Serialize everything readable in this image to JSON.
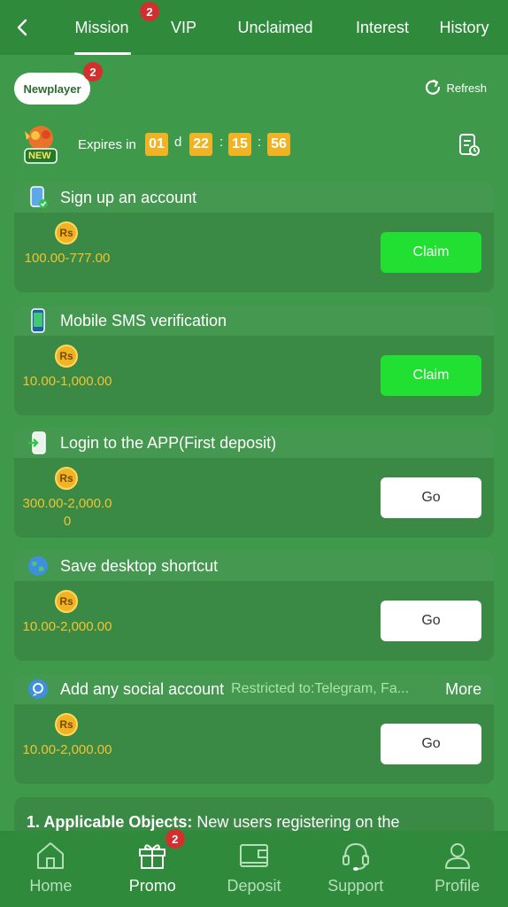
{
  "header": {
    "tabs": [
      {
        "label": "Mission",
        "badge": "2",
        "active": true
      },
      {
        "label": "VIP"
      },
      {
        "label": "Unclaimed"
      },
      {
        "label": "Interest"
      },
      {
        "label": "History"
      }
    ]
  },
  "toolbar": {
    "newplayer_label": "Newplayer",
    "newplayer_badge": "2",
    "refresh_label": "Refresh"
  },
  "expiry": {
    "badge_text": "NEW",
    "label": "Expires in",
    "days": "01",
    "days_unit": "d",
    "hours": "22",
    "minutes": "15",
    "seconds": "56",
    "separator": ":"
  },
  "missions": [
    {
      "title": "Sign up an account",
      "currency": "Rs",
      "amount": "100.00-777.00",
      "button": "Claim",
      "button_type": "claim",
      "icon": "phone-check-icon"
    },
    {
      "title": "Mobile SMS verification",
      "currency": "Rs",
      "amount": "10.00-1,000.00",
      "button": "Claim",
      "button_type": "claim",
      "icon": "mobile-sms-icon"
    },
    {
      "title": "Login to the APP(First deposit)",
      "currency": "Rs",
      "amount": "300.00-2,000.00",
      "button": "Go",
      "button_type": "go",
      "icon": "app-login-icon"
    },
    {
      "title": "Save desktop shortcut",
      "currency": "Rs",
      "amount": "10.00-2,000.00",
      "button": "Go",
      "button_type": "go",
      "icon": "globe-icon"
    },
    {
      "title": "Add any social account",
      "restriction": "Restricted to:Telegram, Fa...",
      "more": "More",
      "currency": "Rs",
      "amount": "10.00-2,000.00",
      "button": "Go",
      "button_type": "go",
      "icon": "social-chat-icon"
    }
  ],
  "rules": {
    "heading": "1. Applicable Objects:",
    "text": "New users registering on the"
  },
  "bottom_nav": [
    {
      "label": "Home",
      "icon": "home-icon"
    },
    {
      "label": "Promo",
      "icon": "gift-icon",
      "badge": "2",
      "active": true
    },
    {
      "label": "Deposit",
      "icon": "wallet-icon"
    },
    {
      "label": "Support",
      "icon": "headset-icon"
    },
    {
      "label": "Profile",
      "icon": "user-icon"
    }
  ],
  "colors": {
    "background": "#3e9a4a",
    "header": "#2f8a3c",
    "card": "#3a8a45",
    "claim_button": "#22e032",
    "countdown": "#f0b323",
    "amount": "#f3c232",
    "badge": "#d32f2f"
  }
}
